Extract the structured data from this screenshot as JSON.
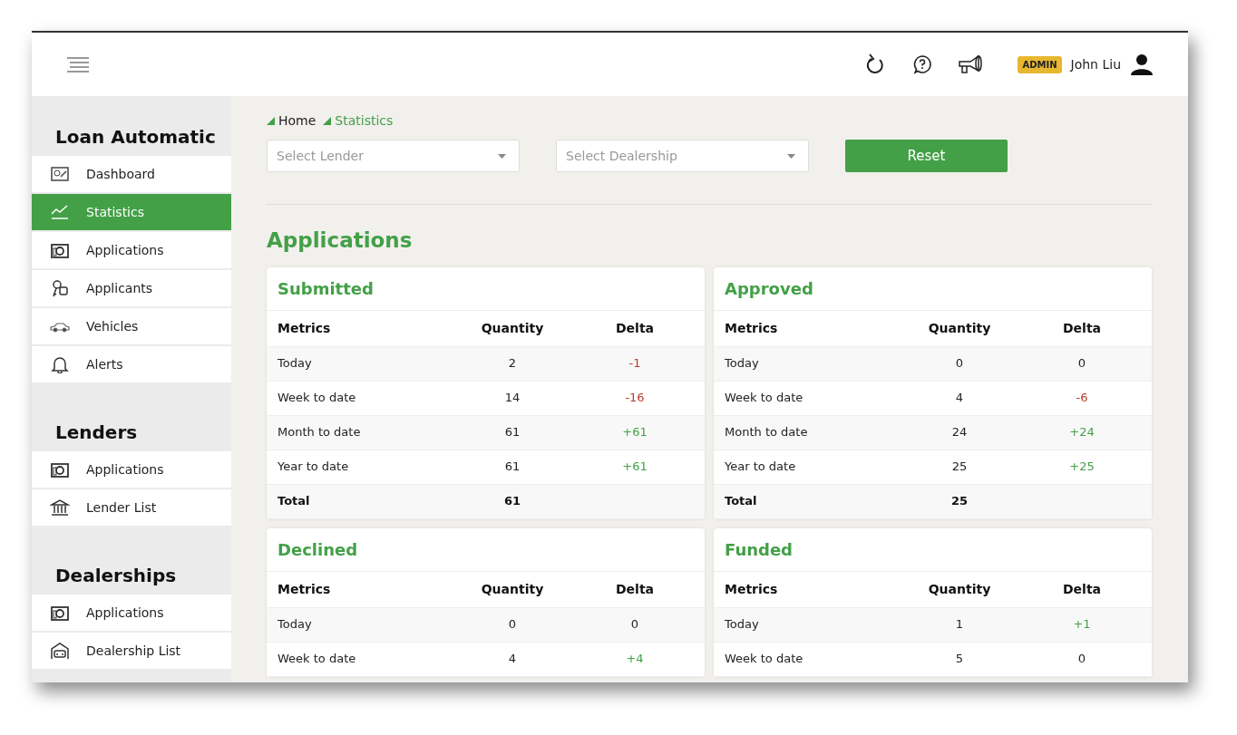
{
  "header": {
    "role_badge": "ADMIN",
    "user_name": "John Liu"
  },
  "sidebar": {
    "sections": [
      {
        "title": "Loan Automatic",
        "items": [
          {
            "label": "Dashboard",
            "kind": "dashboard",
            "selected": false
          },
          {
            "label": "Statistics",
            "kind": "chart",
            "selected": true
          },
          {
            "label": "Applications",
            "kind": "doc",
            "selected": false
          },
          {
            "label": "Applicants",
            "kind": "people",
            "selected": false
          },
          {
            "label": "Vehicles",
            "kind": "car",
            "selected": false
          },
          {
            "label": "Alerts",
            "kind": "bell",
            "selected": false
          }
        ]
      },
      {
        "title": "Lenders",
        "items": [
          {
            "label": "Applications",
            "kind": "doc",
            "selected": false
          },
          {
            "label": "Lender List",
            "kind": "bank",
            "selected": false
          }
        ]
      },
      {
        "title": "Dealerships",
        "items": [
          {
            "label": "Applications",
            "kind": "doc",
            "selected": false
          },
          {
            "label": "Dealership List",
            "kind": "dealer",
            "selected": false
          }
        ]
      }
    ]
  },
  "breadcrumb": [
    {
      "label": "Home",
      "current": false
    },
    {
      "label": "Statistics",
      "current": true
    }
  ],
  "filters": [
    {
      "placeholder": "Select Lender"
    },
    {
      "placeholder": "Select Dealership"
    }
  ],
  "reset_button": "Reset",
  "section_title": "Applications",
  "cards": [
    {
      "title": "Submitted",
      "columns": [
        "Metrics",
        "Quantity",
        "Delta"
      ],
      "rows": [
        {
          "metric": "Today",
          "quantity": "2",
          "delta": "-1",
          "color": "#c0392b"
        },
        {
          "metric": "Week to date",
          "quantity": "14",
          "delta": "-16",
          "color": "#c0392b"
        },
        {
          "metric": "Month to date",
          "quantity": "61",
          "delta": "+61",
          "color": "#43a047"
        },
        {
          "metric": "Year to date",
          "quantity": "61",
          "delta": "+61",
          "color": "#43a047"
        }
      ],
      "total": {
        "metric": "Total",
        "quantity": "61"
      }
    },
    {
      "title": "Approved",
      "columns": [
        "Metrics",
        "Quantity",
        "Delta"
      ],
      "rows": [
        {
          "metric": "Today",
          "quantity": "0",
          "delta": "0",
          "color": "#222222"
        },
        {
          "metric": "Week to date",
          "quantity": "4",
          "delta": "-6",
          "color": "#c0392b"
        },
        {
          "metric": "Month to date",
          "quantity": "24",
          "delta": "+24",
          "color": "#43a047"
        },
        {
          "metric": "Year to date",
          "quantity": "25",
          "delta": "+25",
          "color": "#43a047"
        }
      ],
      "total": {
        "metric": "Total",
        "quantity": "25"
      }
    },
    {
      "title": "Declined",
      "columns": [
        "Metrics",
        "Quantity",
        "Delta"
      ],
      "rows": [
        {
          "metric": "Today",
          "quantity": "0",
          "delta": "0",
          "color": "#222222"
        },
        {
          "metric": "Week to date",
          "quantity": "4",
          "delta": "+4",
          "color": "#43a047"
        }
      ]
    },
    {
      "title": "Funded",
      "columns": [
        "Metrics",
        "Quantity",
        "Delta"
      ],
      "rows": [
        {
          "metric": "Today",
          "quantity": "1",
          "delta": "+1",
          "color": "#43a047"
        },
        {
          "metric": "Week to date",
          "quantity": "5",
          "delta": "0",
          "color": "#222222"
        }
      ]
    }
  ]
}
